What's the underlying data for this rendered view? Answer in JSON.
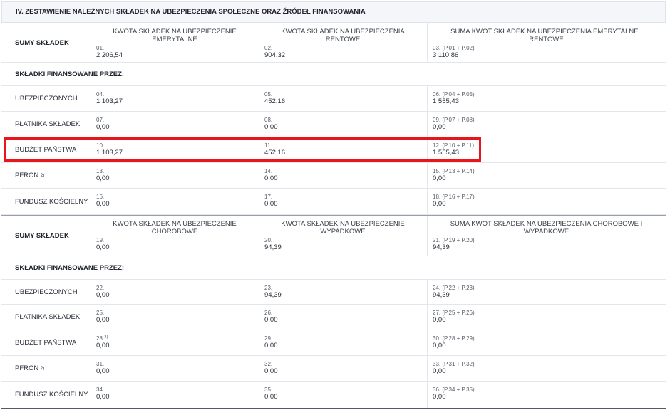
{
  "section_title": "IV. ZESTAWIENIE NALEŻNYCH SKŁADEK NA UBEZPIECZENIA SPOŁECZNE ORAZ ŹRÓDEŁ FINANSOWANIA",
  "part1": {
    "sum_label": "SUMY SKŁADEK",
    "headers": [
      "KWOTA SKŁADEK NA UBEZPIECZENIE EMERYTALNE",
      "KWOTA SKŁADEK NA UBEZPIECZENIA RENTOWE",
      "SUMA KWOT SKŁADEK NA UBEZPIECZENIA EMERYTALNE I RENTOWE"
    ],
    "sum_cells": [
      {
        "num": "01.",
        "val": "2 206,54"
      },
      {
        "num": "02.",
        "val": "904,32"
      },
      {
        "num": "03. (P.01 + P.02)",
        "val": "3 110,86"
      }
    ],
    "financed_by": "SKŁADKI FINANSOWANE PRZEZ:",
    "rows": [
      {
        "label": "UBEZPIECZONYCH",
        "sup": "",
        "cells": [
          {
            "num": "04.",
            "sup": "",
            "val": "1 103,27"
          },
          {
            "num": "05.",
            "sup": "",
            "val": "452,16"
          },
          {
            "num": "06. (P.04 + P.05)",
            "sup": "",
            "val": "1 555,43"
          }
        ]
      },
      {
        "label": "PŁATNIKA SKŁADEK",
        "sup": "",
        "cells": [
          {
            "num": "07.",
            "sup": "",
            "val": "0,00"
          },
          {
            "num": "08.",
            "sup": "",
            "val": "0,00"
          },
          {
            "num": "09. (P.07 + P.08)",
            "sup": "",
            "val": "0,00"
          }
        ]
      },
      {
        "label": "BUDŻET PAŃSTWA",
        "sup": "",
        "cells": [
          {
            "num": "10.",
            "sup": "",
            "val": "1 103,27"
          },
          {
            "num": "11.",
            "sup": "",
            "val": "452,16"
          },
          {
            "num": "12. (P.10 + P.11)",
            "sup": "",
            "val": "1 555,43"
          }
        ]
      },
      {
        "label": "PFRON",
        "sup": "2)",
        "cells": [
          {
            "num": "13.",
            "sup": "",
            "val": "0,00"
          },
          {
            "num": "14.",
            "sup": "",
            "val": "0,00"
          },
          {
            "num": "15. (P.13 + P.14)",
            "sup": "",
            "val": "0,00"
          }
        ]
      },
      {
        "label": "FUNDUSZ KOŚCIELNY",
        "sup": "",
        "cells": [
          {
            "num": "16.",
            "sup": "",
            "val": "0,00"
          },
          {
            "num": "17.",
            "sup": "",
            "val": "0,00"
          },
          {
            "num": "18. (P.16 + P.17)",
            "sup": "",
            "val": "0,00"
          }
        ]
      }
    ]
  },
  "part2": {
    "sum_label": "SUMY SKŁADEK",
    "headers": [
      "KWOTA SKŁADEK NA UBEZPIECZENIE CHOROBOWE",
      "KWOTA SKŁADEK NA UBEZPIECZENIE WYPADKOWE",
      "SUMA KWOT SKŁADEK NA UBEZPIECZENIA CHOROBOWE I WYPADKOWE"
    ],
    "sum_cells": [
      {
        "num": "19.",
        "val": "0,00"
      },
      {
        "num": "20.",
        "val": "94,39"
      },
      {
        "num": "21. (P.19 + P.20)",
        "val": "94,39"
      }
    ],
    "financed_by": "SKŁADKI FINANSOWANE PRZEZ:",
    "rows": [
      {
        "label": "UBEZPIECZONYCH",
        "sup": "",
        "cells": [
          {
            "num": "22.",
            "sup": "",
            "val": "0,00"
          },
          {
            "num": "23.",
            "sup": "",
            "val": "94,39"
          },
          {
            "num": "24. (P.22 + P.23)",
            "sup": "",
            "val": "94,39"
          }
        ]
      },
      {
        "label": "PŁATNIKA SKŁADEK",
        "sup": "",
        "cells": [
          {
            "num": "25.",
            "sup": "",
            "val": "0,00"
          },
          {
            "num": "26.",
            "sup": "",
            "val": "0,00"
          },
          {
            "num": "27. (P.25 + P.26)",
            "sup": "",
            "val": "0,00"
          }
        ]
      },
      {
        "label": "BUDŻET PAŃSTWA",
        "sup": "",
        "cells": [
          {
            "num": "28.",
            "sup": "3)",
            "val": "0,00"
          },
          {
            "num": "29.",
            "sup": "",
            "val": "0,00"
          },
          {
            "num": "30. (P.28 + P.29)",
            "sup": "",
            "val": "0,00"
          }
        ]
      },
      {
        "label": "PFRON",
        "sup": "2)",
        "cells": [
          {
            "num": "31.",
            "sup": "",
            "val": "0,00"
          },
          {
            "num": "32.",
            "sup": "",
            "val": "0,00"
          },
          {
            "num": "33. (P.31 + P.32)",
            "sup": "",
            "val": "0,00"
          }
        ]
      },
      {
        "label": "FUNDUSZ KOŚCIELNY",
        "sup": "",
        "cells": [
          {
            "num": "34.",
            "sup": "",
            "val": "0,00"
          },
          {
            "num": "35.",
            "sup": "",
            "val": "0,00"
          },
          {
            "num": "36. (P.34 + P.35)",
            "sup": "",
            "val": "0,00"
          }
        ]
      }
    ]
  },
  "highlight_color": "#e8151b"
}
